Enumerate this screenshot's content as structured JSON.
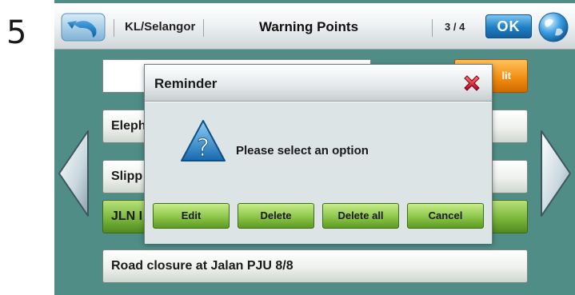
{
  "step_number": "5",
  "header": {
    "region": "KL/Selangor",
    "title": "Warning Points",
    "page_indicator": "3 / 4",
    "ok_label": "OK"
  },
  "list": {
    "top_action_label": "lit",
    "rows": [
      {
        "label": "Eleph"
      },
      {
        "label": "Slipp"
      },
      {
        "label": "JLN I"
      },
      {
        "label": "Road closure at Jalan PJU 8/8"
      }
    ]
  },
  "dialog": {
    "title": "Reminder",
    "message": "Please select an option",
    "buttons": [
      "Edit",
      "Delete",
      "Delete all",
      "Cancel"
    ]
  },
  "colors": {
    "background_teal": "#4f8d86",
    "green_button": "#8cc64a",
    "orange_button": "#f08a10",
    "ok_blue": "#1e7fc4"
  },
  "icons": {
    "back": "undo-arrow-icon",
    "globe": "globe-icon",
    "close": "red-x-close-icon",
    "question": "question-triangle-icon",
    "prev": "left-arrow-icon",
    "next": "right-arrow-icon"
  }
}
